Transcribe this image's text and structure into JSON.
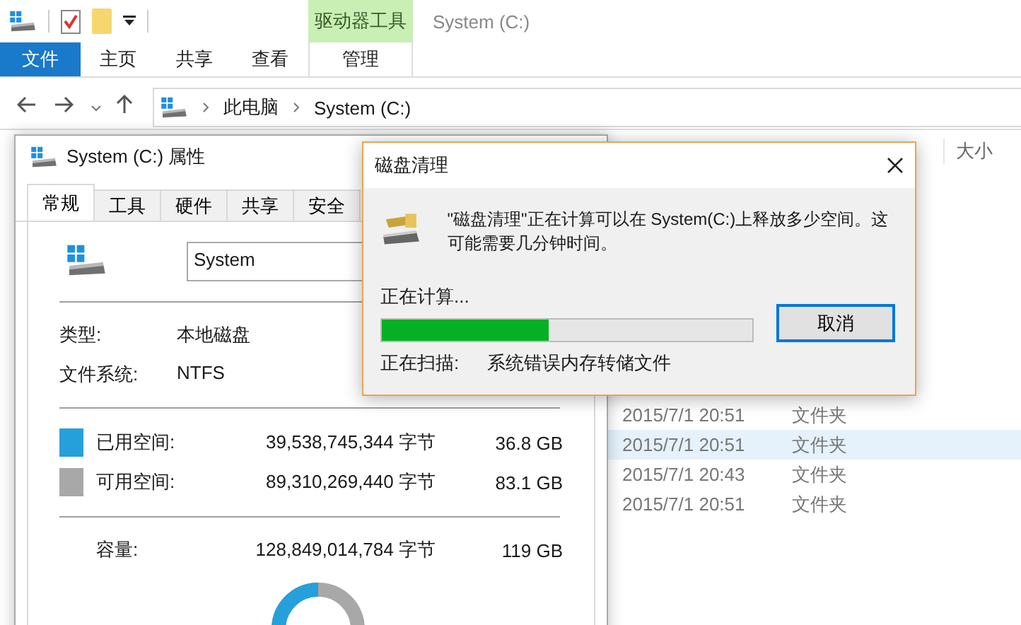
{
  "explorer": {
    "contextual_group": "驱动器工具",
    "title": "System (C:)",
    "ribbon_tabs": [
      {
        "label": "文件",
        "kind": "file"
      },
      {
        "label": "主页",
        "kind": "tab"
      },
      {
        "label": "共享",
        "kind": "tab"
      },
      {
        "label": "查看",
        "kind": "tab"
      },
      {
        "label": "管理",
        "kind": "contextual"
      }
    ],
    "address_path": [
      "此电脑",
      "System (C:)"
    ],
    "column_header": "大小",
    "rows": [
      {
        "modified": "2015/7/1 20:51",
        "type": "文件夹",
        "selected": false
      },
      {
        "modified": "2015/7/1 20:51",
        "type": "文件夹",
        "selected": true
      },
      {
        "modified": "2015/7/1 20:43",
        "type": "文件夹",
        "selected": false
      },
      {
        "modified": "2015/7/1 20:51",
        "type": "文件夹",
        "selected": false
      }
    ]
  },
  "properties": {
    "title": "System (C:) 属性",
    "tabs": [
      {
        "label": "常规",
        "selected": true
      },
      {
        "label": "工具",
        "selected": false
      },
      {
        "label": "硬件",
        "selected": false
      },
      {
        "label": "共享",
        "selected": false
      },
      {
        "label": "安全",
        "selected": false
      }
    ],
    "name_value": "System",
    "info": [
      {
        "label": "类型:",
        "value": "本地磁盘"
      },
      {
        "label": "文件系统:",
        "value": "NTFS"
      }
    ],
    "space": [
      {
        "label": "已用空间:",
        "bytes": "39,538,745,344 字节",
        "size": "36.8 GB",
        "color": "#26a0da"
      },
      {
        "label": "可用空间:",
        "bytes": "89,310,269,440 字节",
        "size": "83.1 GB",
        "color": "#a8a8a8"
      }
    ],
    "capacity": {
      "label": "容量:",
      "bytes": "128,849,014,784 字节",
      "size": "119 GB"
    }
  },
  "cleanup": {
    "title": "磁盘清理",
    "message": "\"磁盘清理\"正在计算可以在 System(C:)上释放多少空间。这可能需要几分钟时间。",
    "status": "正在计算...",
    "progress": {
      "level": 0.45
    },
    "cancel": "取消",
    "scanning_label": "正在扫描:",
    "scanning_item": "系统错误内存转储文件"
  }
}
